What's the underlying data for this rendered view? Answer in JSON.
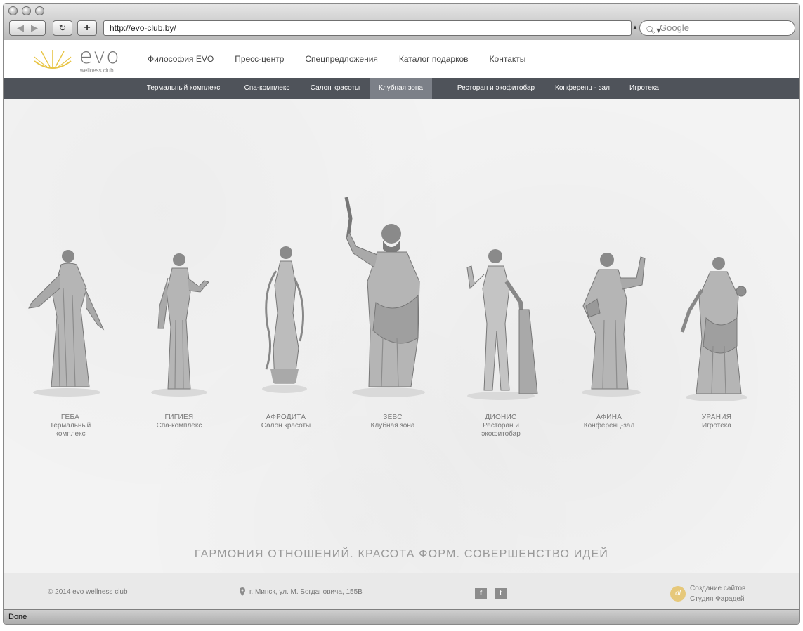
{
  "browser": {
    "url": "http://evo-club.by/",
    "search_placeholder": "Google",
    "back_icon": "back-arrow-icon",
    "forward_icon": "forward-arrow-icon",
    "reload_icon": "reload-icon",
    "add_icon": "plus-icon",
    "status": "Done"
  },
  "header": {
    "logo_text": "evo",
    "logo_sub": "wellness club",
    "menu": [
      "Философия EVO",
      "Пресс-центр",
      "Спецпредложения",
      "Каталог подарков",
      "Контакты"
    ]
  },
  "subnav": {
    "items": [
      "Термальный комплекс",
      "Спа-комплекс",
      "Салон красоты",
      "Клубная зона",
      "Ресторан и экофитобар",
      "Конференц - зал",
      "Игротека"
    ],
    "active": "Клубная зона"
  },
  "statues": [
    {
      "name": "ГЕБА",
      "desc": "Термальный комплекс"
    },
    {
      "name": "ГИГИЕЯ",
      "desc": "Спа-комплекс"
    },
    {
      "name": "АФРОДИТА",
      "desc": "Салон красоты"
    },
    {
      "name": "ЗЕВС",
      "desc": "Клубная зона"
    },
    {
      "name": "ДИОНИС",
      "desc": "Ресторан и экофитобар"
    },
    {
      "name": "АФИНА",
      "desc": "Конференц-зал"
    },
    {
      "name": "УРАНИЯ",
      "desc": "Игротека"
    }
  ],
  "tagline": "ГАРМОНИЯ ОТНОШЕНИЙ. КРАСОТА ФОРМ. СОВЕРШЕНСТВО ИДЕЙ",
  "footer": {
    "copyright": "© 2014 evo wellness club",
    "address": "г. Минск, ул. М. Богдановича, 155В",
    "facebook_label": "f",
    "twitter_label": "t",
    "credit_line1": "Создание сайтов",
    "credit_line2": "Студия Фарадей"
  },
  "colors": {
    "accent": "#e8c547",
    "subnav_bg": "#4f535a",
    "subnav_active": "#7c8088"
  }
}
